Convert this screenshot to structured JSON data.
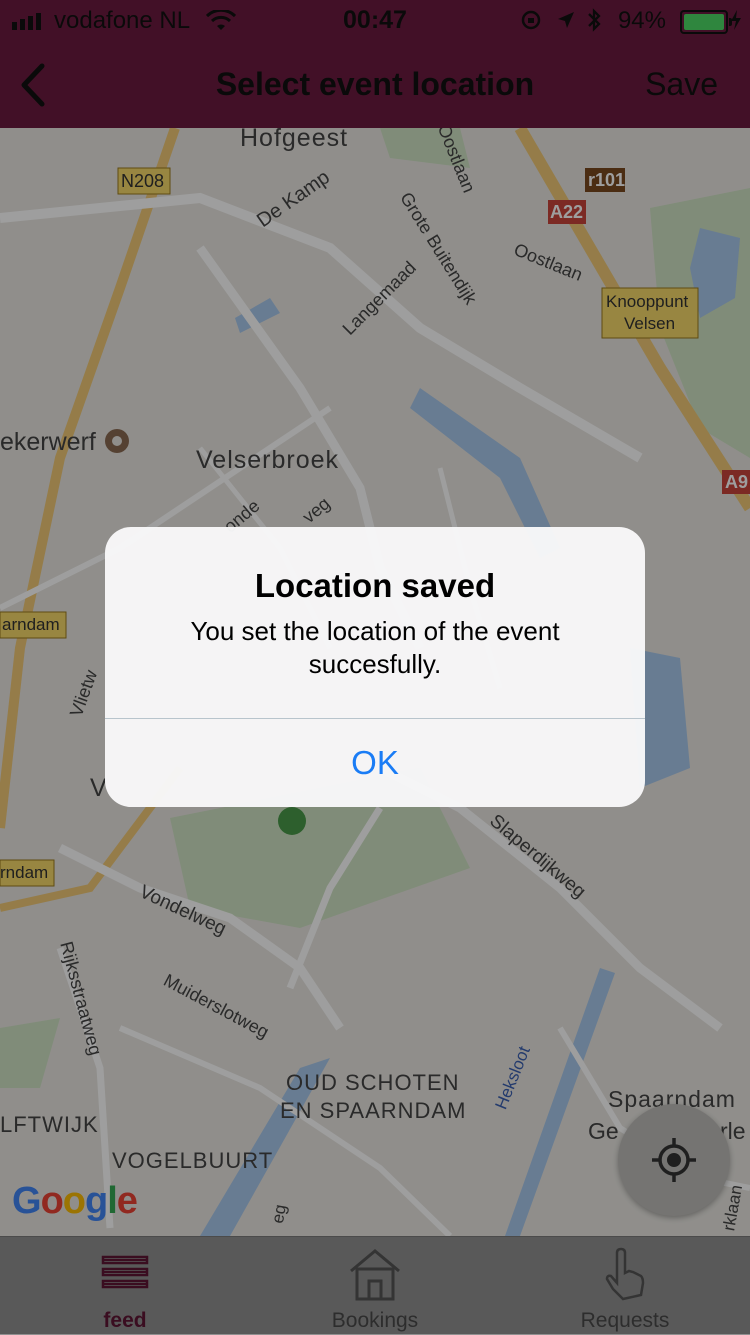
{
  "status_bar": {
    "carrier": "vodafone NL",
    "time": "00:47",
    "battery": "94%"
  },
  "nav": {
    "title": "Select event location",
    "save_label": "Save"
  },
  "map": {
    "labels": [
      "Hofgeest",
      "N208",
      "De Kamp",
      "Grote Buitendijk",
      "Oostlaan",
      "Oostlaan",
      "r101",
      "A22",
      "Knooppunt",
      "Velsen",
      "Langemaad",
      "ekerwerf",
      "Velserbroek",
      "onde",
      "veg",
      "A9",
      "arndam",
      "Vlietw",
      "V",
      "Slaperdijkweg",
      "rndam",
      "Vondelweg",
      "Rijksstraatweg",
      "Muiderslotweg",
      "OUD SCHOTEN",
      "EN SPAARNDAM",
      "Heksloot",
      "Spaarndam",
      "Ge",
      "rle",
      "LFTWIJK",
      "VOGELBUURT",
      "rklaan",
      "eg"
    ],
    "logo": "Google"
  },
  "alert": {
    "title": "Location saved",
    "message": "You set the location of the event succesfully.",
    "ok_label": "OK"
  },
  "tabs": [
    {
      "label": "feed",
      "icon": "list-icon",
      "active": true
    },
    {
      "label": "Bookings",
      "icon": "house-icon",
      "active": false
    },
    {
      "label": "Requests",
      "icon": "hand-pointer-icon",
      "active": false
    }
  ],
  "colors": {
    "nav": "#6b1b3f",
    "alert_ok": "#1a7cf5",
    "battery": "#4cd964",
    "tab_active": "#5e1534"
  }
}
